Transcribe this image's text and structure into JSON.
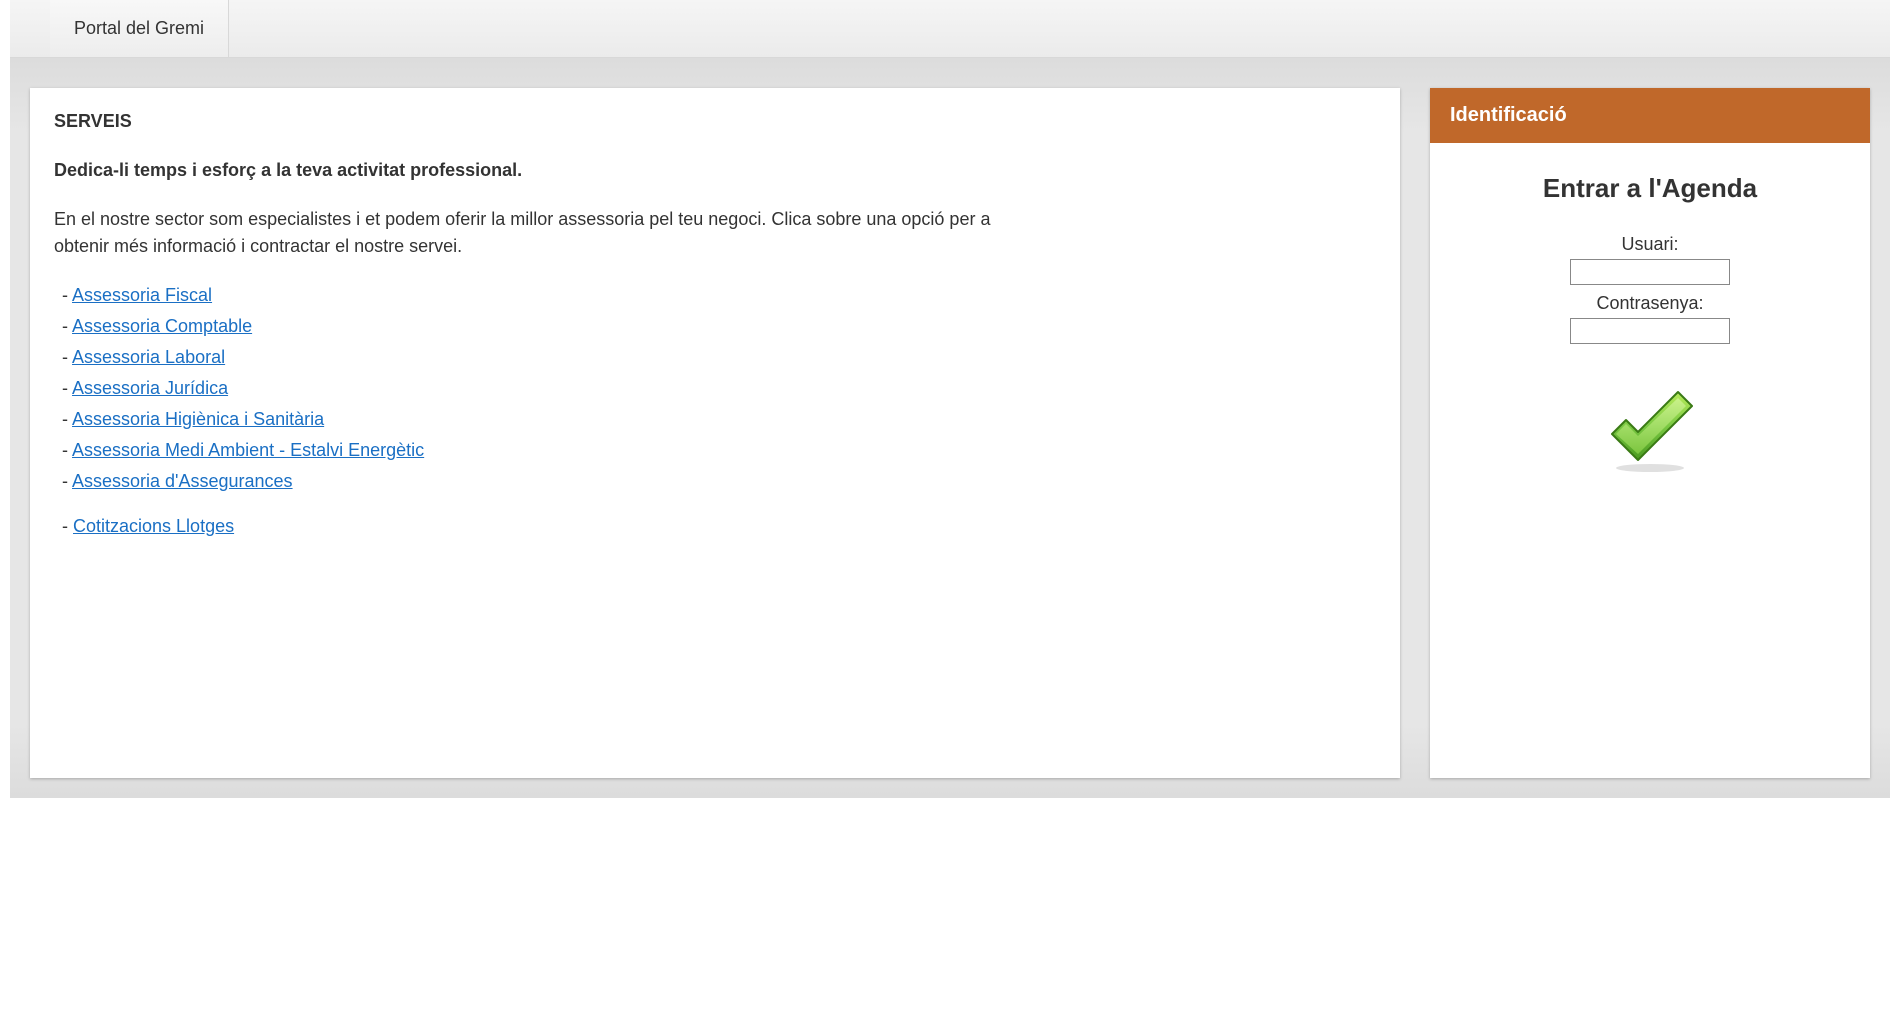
{
  "header": {
    "tab_label": "Portal del Gremi"
  },
  "main": {
    "heading": "SERVEIS",
    "intro_strong": "Dedica-li temps i esforç a la teva activitat professional.",
    "intro_desc": "En el nostre sector som especialistes i et podem oferir la millor assessoria pel teu negoci. Clica sobre una opció per a obtenir més informació i contractar el nostre servei.",
    "links_group1": [
      "Assessoria Fiscal",
      "Assessoria Comptable",
      "Assessoria Laboral",
      "Assessoria Jurídica",
      "Assessoria Higiènica i Sanitària",
      "Assessoria Medi Ambient - Estalvi Energètic",
      "Assessoria d'Assegurances"
    ],
    "links_group2": [
      "Cotitzacions Llotges"
    ]
  },
  "sidebar": {
    "header": "Identificació",
    "title": "Entrar a l'Agenda",
    "user_label": "Usuari:",
    "password_label": "Contrasenya:"
  }
}
